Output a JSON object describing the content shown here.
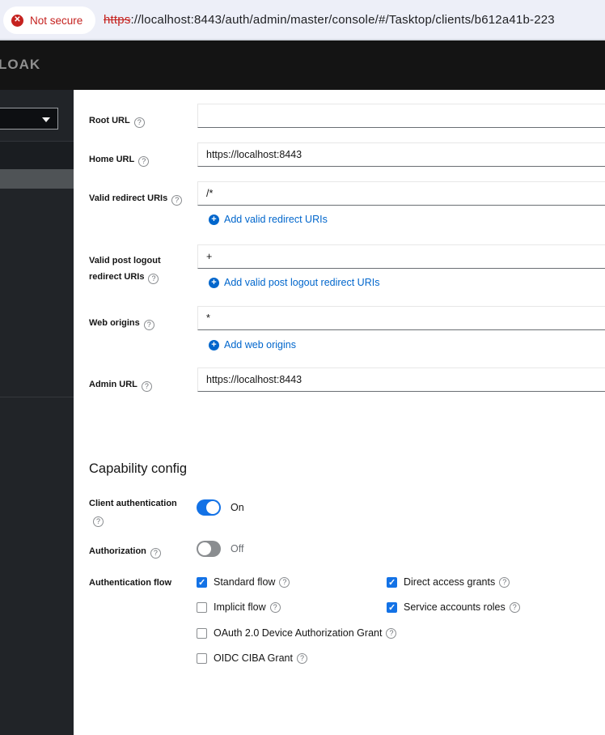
{
  "browser": {
    "security_badge": "Not secure",
    "url_scheme": "https",
    "url_rest": "://localhost:8443/auth/admin/master/console/#/Tasktop/clients/b612a41b-223"
  },
  "header": {
    "logo_fragment": "LOAK"
  },
  "form": {
    "fields": [
      {
        "label": "Root URL",
        "value": ""
      },
      {
        "label": "Home URL",
        "value": "https://localhost:8443"
      },
      {
        "label": "Valid redirect URIs",
        "value": "/*",
        "add_label": "Add valid redirect URIs"
      },
      {
        "label": "Valid post logout redirect URIs",
        "value": "+",
        "add_label": "Add valid post logout redirect URIs"
      },
      {
        "label": "Web origins",
        "value": "*",
        "add_label": "Add web origins"
      },
      {
        "label": "Admin URL",
        "value": "https://localhost:8443"
      }
    ]
  },
  "capability": {
    "heading": "Capability config",
    "toggles": [
      {
        "label": "Client authentication",
        "state": "On"
      },
      {
        "label": "Authorization",
        "state": "Off"
      }
    ],
    "auth_flow_label": "Authentication flow",
    "checkboxes": [
      {
        "label": "Standard flow",
        "checked": true
      },
      {
        "label": "Direct access grants",
        "checked": true
      },
      {
        "label": "Implicit flow",
        "checked": false
      },
      {
        "label": "Service accounts roles",
        "checked": true
      },
      {
        "label": "OAuth 2.0 Device Authorization Grant",
        "checked": false
      },
      {
        "label": "OIDC CIBA Grant",
        "checked": false
      }
    ]
  },
  "colors": {
    "link_blue": "#0066cc",
    "control_blue": "#1372e6",
    "danger_red": "#c5221f",
    "sidebar_selected": "#4f5356",
    "header_black": "#141414"
  }
}
